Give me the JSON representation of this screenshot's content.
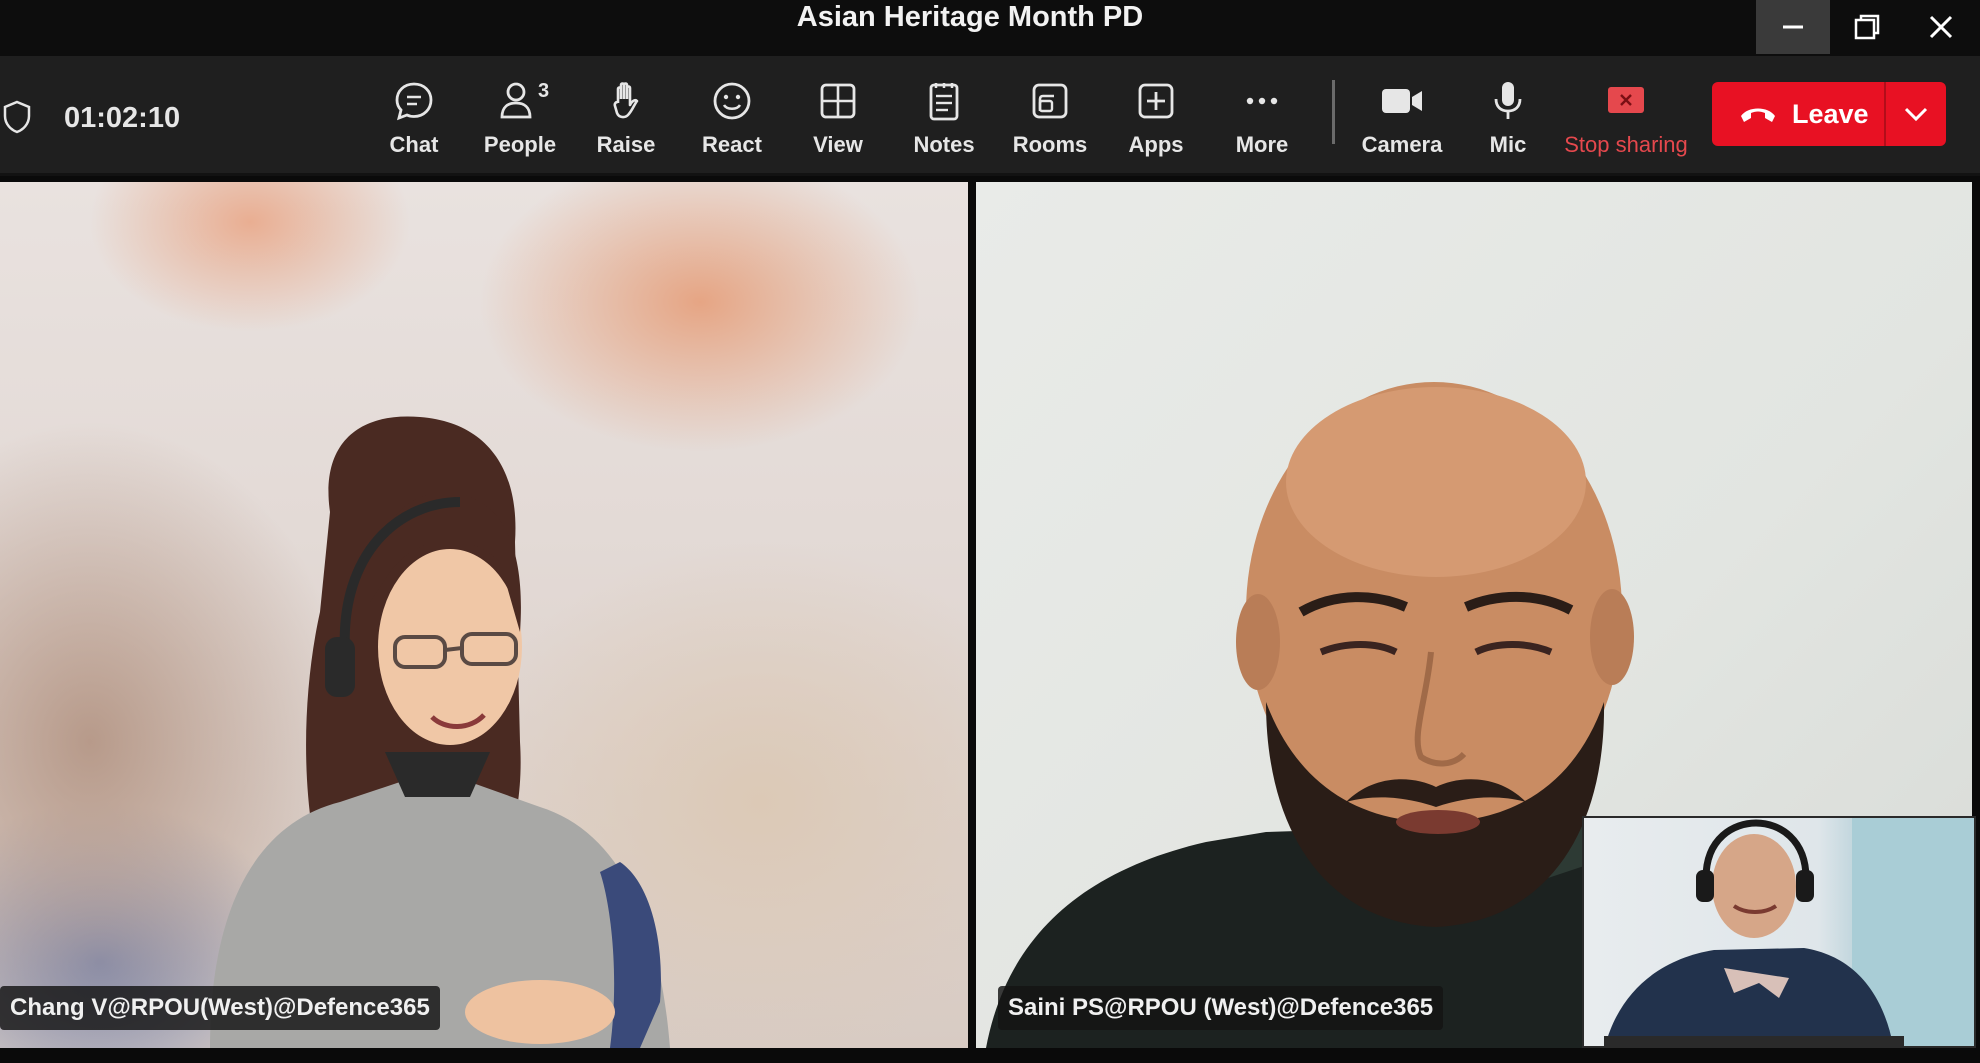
{
  "window": {
    "title": "Asian Heritage Month PD"
  },
  "toolbar": {
    "timer": "01:02:10",
    "people_count": "3",
    "items": [
      {
        "label": "Chat",
        "icon": "chat-icon"
      },
      {
        "label": "People",
        "icon": "people-icon"
      },
      {
        "label": "Raise",
        "icon": "raise-hand-icon"
      },
      {
        "label": "React",
        "icon": "react-smiley-icon"
      },
      {
        "label": "View",
        "icon": "view-grid-icon"
      },
      {
        "label": "Notes",
        "icon": "notes-icon"
      },
      {
        "label": "Rooms",
        "icon": "rooms-icon"
      },
      {
        "label": "Apps",
        "icon": "apps-plus-icon"
      },
      {
        "label": "More",
        "icon": "more-dots-icon"
      },
      {
        "label": "Camera",
        "icon": "camera-icon"
      },
      {
        "label": "Mic",
        "icon": "mic-icon"
      },
      {
        "label": "Stop sharing",
        "icon": "stop-sharing-icon"
      }
    ],
    "leave_label": "Leave"
  },
  "participants": {
    "left_name": "Chang V@RPOU(West)@Defence365",
    "right_name": "Saini PS@RPOU (West)@Defence365"
  },
  "colors": {
    "leave": "#e81123",
    "stop_sharing": "#e5484d",
    "toolbar_bg": "#1f1f1f"
  }
}
